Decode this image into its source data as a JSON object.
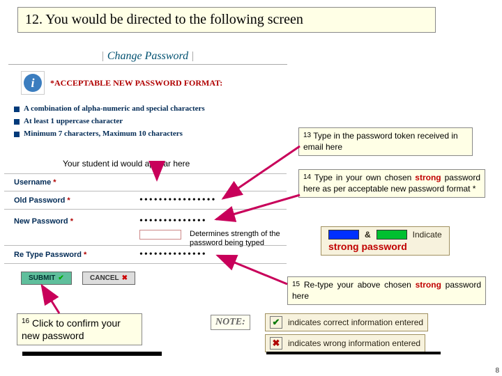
{
  "title": "12. You would be directed to the following screen",
  "form": {
    "header": "Change Password",
    "info_heading_prefix": "*",
    "info_heading": "ACCEPTABLE NEW PASSWORD FORMAT:",
    "bullets": [
      "A combination of alpha-numeric and special characters",
      "At least 1 uppercase character",
      "Minimum 7 characters, Maximum 10 characters"
    ],
    "fields": {
      "username": "Username",
      "old_password": "Old Password",
      "new_password": "New Password",
      "retype_password": "Re Type Password"
    },
    "old_pw_value": "••••••••••••••••",
    "new_pw_value": "••••••••••••••",
    "retype_pw_value": "••••••••••••••",
    "submit": "SUBMIT",
    "cancel": "CANCEL"
  },
  "annotations": {
    "student_id": "Your student id would appear here",
    "strength": "Determines strength of the password being typed",
    "c13_num": "13",
    "c13_text": " Type in the password token received in email here",
    "c14_num": "14",
    "c14_a": " Type in your own chosen ",
    "c14_strong": "strong",
    "c14_b": " password here as per acceptable new password format *",
    "c15_num": "15",
    "c15_a": " Re-type your above chosen ",
    "c15_strong": "strong",
    "c15_b": " password here",
    "c16_num": "16",
    "c16_text": " Click to confirm your new password"
  },
  "note_label": "NOTE:",
  "legend": {
    "amp": "&",
    "indicate": "Indicate",
    "strong_password": "strong password",
    "correct": "indicates correct information entered",
    "wrong": "indicates wrong information entered"
  },
  "page_number": "8"
}
